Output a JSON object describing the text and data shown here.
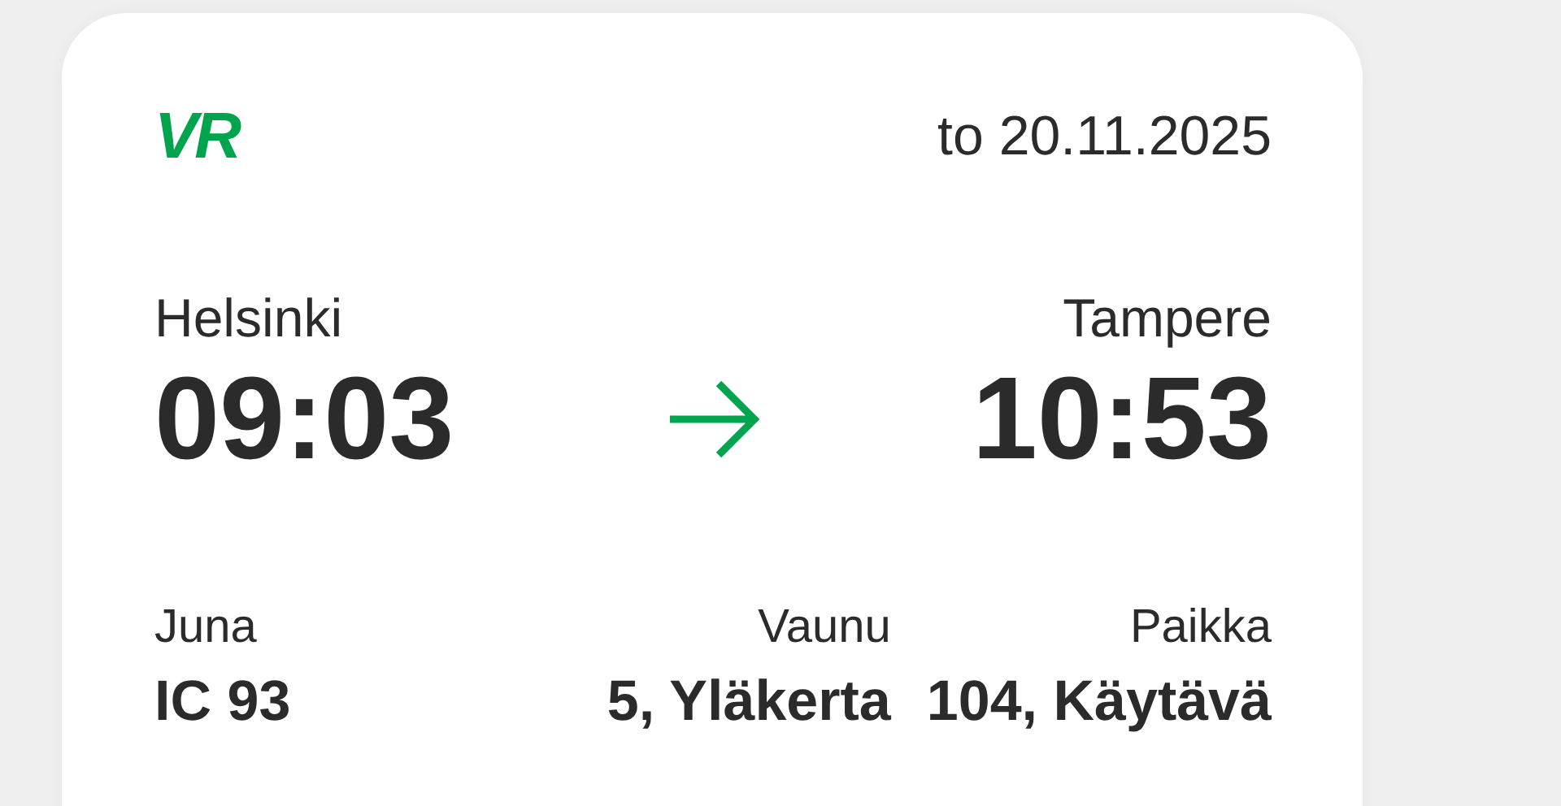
{
  "logo": "VR",
  "date": "to 20.11.2025",
  "from": {
    "station": "Helsinki",
    "time": "09:03"
  },
  "to": {
    "station": "Tampere",
    "time": "10:53"
  },
  "details": [
    {
      "label": "Juna",
      "value": "IC 93"
    },
    {
      "label": "Vaunu",
      "value": "5, Yläkerta"
    },
    {
      "label": "Paikka",
      "value": "104, Käytävä"
    }
  ]
}
